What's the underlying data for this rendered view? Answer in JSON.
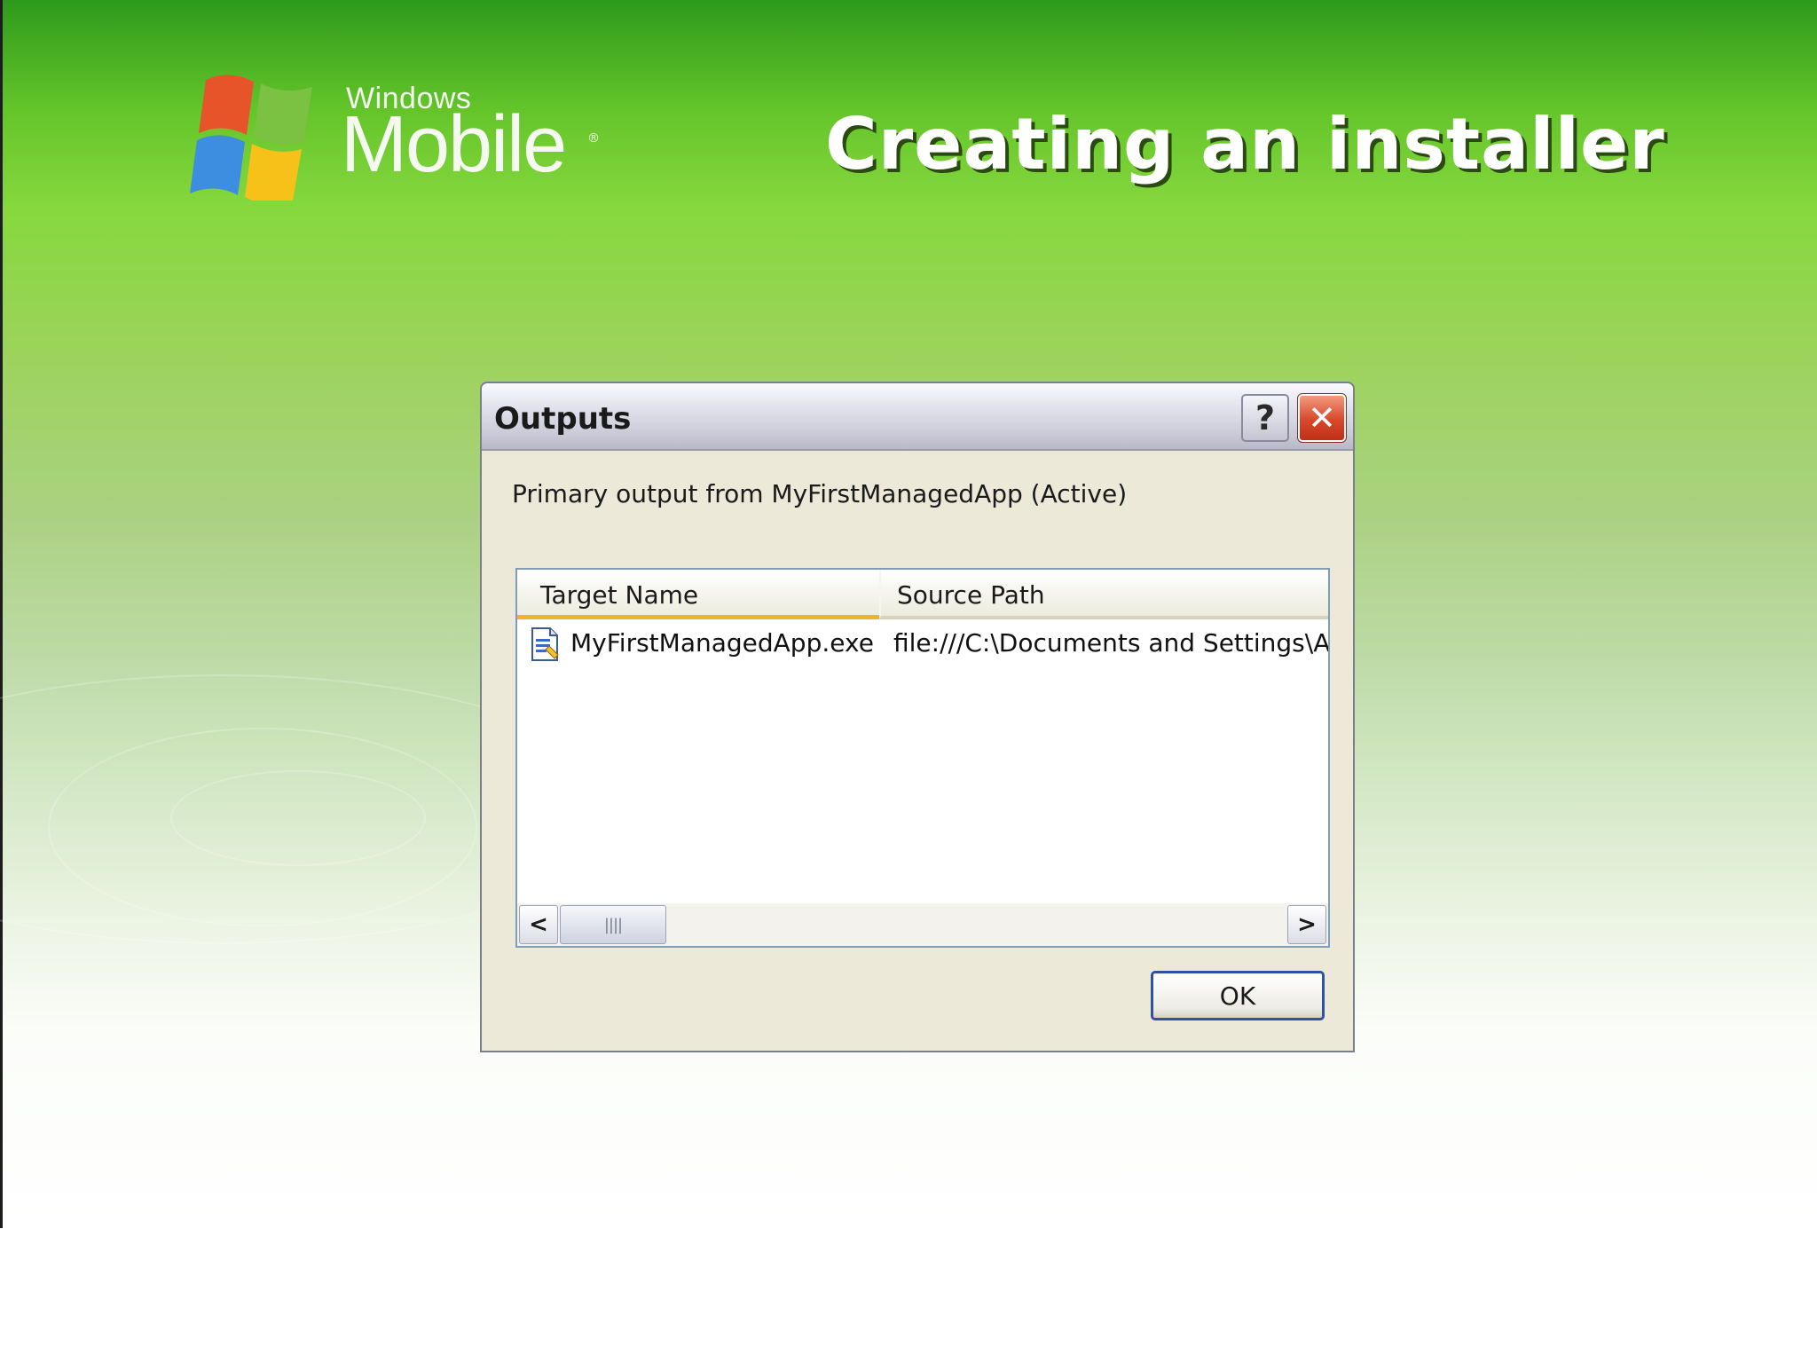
{
  "slide": {
    "title": "Creating an installer",
    "logo": {
      "small_text": "Windows",
      "big_text": "Mobile",
      "reg_mark": "®"
    }
  },
  "dialog": {
    "title": "Outputs",
    "help_label": "?",
    "close_label": "✕",
    "primary_label": "Primary output from MyFirstManagedApp (Active)",
    "columns": [
      "Target Name",
      "Source Path"
    ],
    "rows": [
      {
        "target": "MyFirstManagedApp.exe",
        "source": "file:///C:\\Documents and Settings\\Adr"
      }
    ],
    "scroll_left": "<",
    "scroll_right": ">",
    "scroll_grip": "||||",
    "ok_label": "OK"
  },
  "colors": {
    "background_green": "#86d83e",
    "dialog_face": "#ece9d8",
    "close_red": "#d8482a",
    "ok_border": "#2c52a0",
    "sort_column": "#f0b030"
  },
  "icons": [
    "windows-flag-icon",
    "help-icon",
    "close-icon",
    "exe-file-icon",
    "chevron-left-icon",
    "chevron-right-icon"
  ]
}
